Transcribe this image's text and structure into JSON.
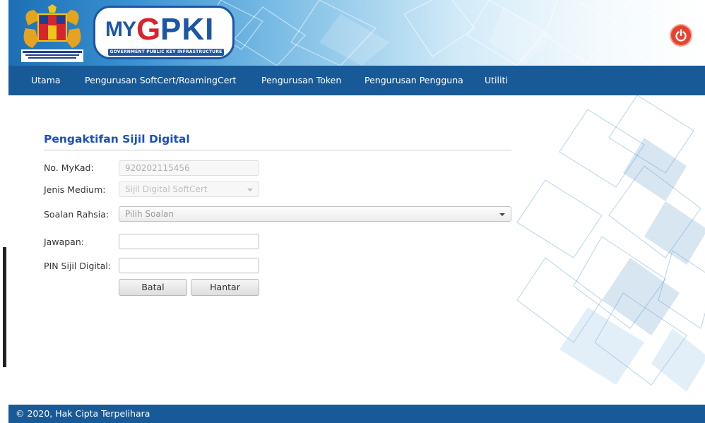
{
  "header": {
    "logo_prefix": "MY",
    "logo_g": "G",
    "logo_main": "PKI",
    "logo_tagline": "GOVERNMENT PUBLIC KEY INFRASTRUCTURE",
    "power_icon": "power-icon"
  },
  "nav": {
    "items": [
      {
        "label": "Utama"
      },
      {
        "label": "Pengurusan SoftCert/RoamingCert"
      },
      {
        "label": "Pengurusan Token"
      },
      {
        "label": "Pengurusan Pengguna"
      },
      {
        "label": "Utiliti"
      }
    ]
  },
  "form": {
    "title": "Pengaktifan Sijil Digital",
    "mykad_label": "No. MyKad:",
    "mykad_value": "920202115456",
    "medium_label": "Jenis Medium:",
    "medium_value": "Sijil Digital SoftCert",
    "question_label": "Soalan Rahsia:",
    "question_value": "Pilih Soalan",
    "answer_label": "Jawapan:",
    "answer_value": "",
    "pin_label": "PIN Sijil Digital:",
    "pin_value": "",
    "cancel_label": "Batal",
    "submit_label": "Hantar"
  },
  "footer": {
    "copyright": "© 2020, Hak Cipta Terpelihara"
  },
  "colors": {
    "nav_bg": "#185a97",
    "title": "#1a4fc4",
    "power": "#e8412e"
  }
}
